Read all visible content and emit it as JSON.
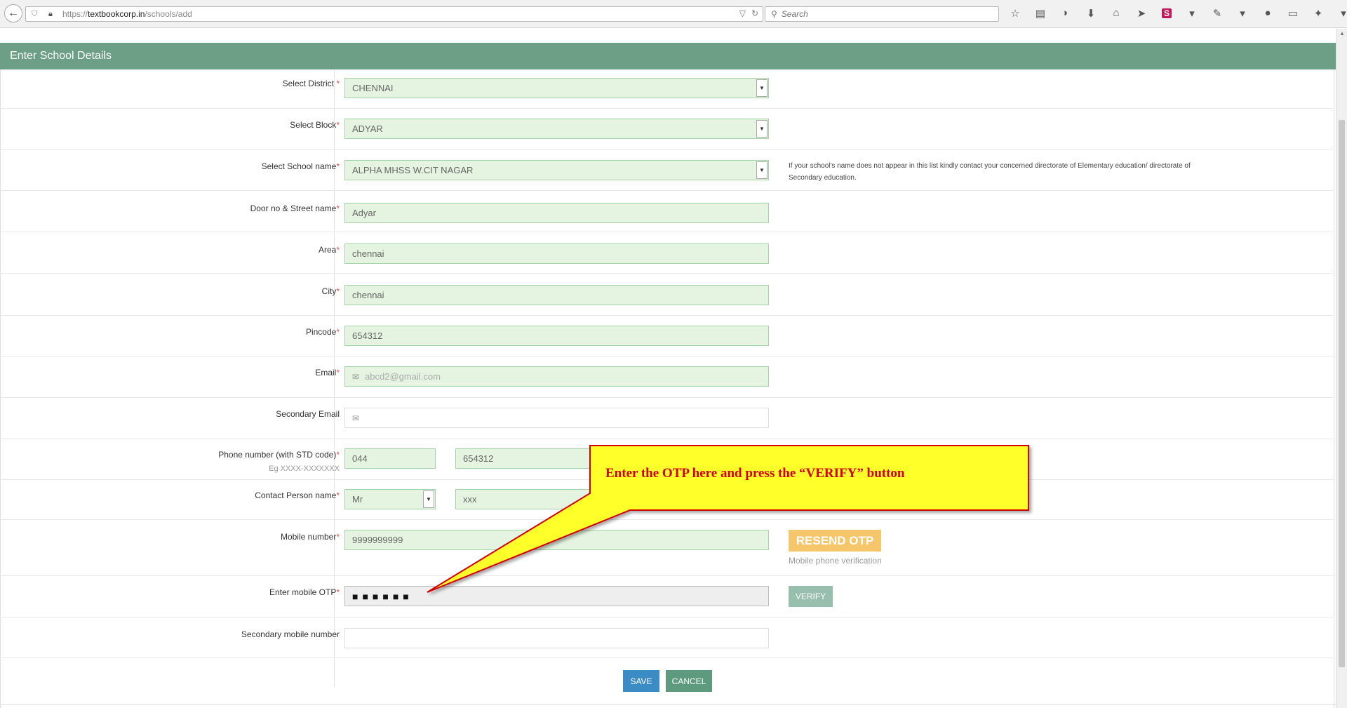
{
  "browser": {
    "url_prefix": "https://",
    "url_host": "textbookcorp.in",
    "url_path": "/schools/add",
    "search_placeholder": "Search",
    "profile_badge": "S"
  },
  "panel": {
    "title": "Enter School Details"
  },
  "form": {
    "district": {
      "label": "Select District",
      "value": "CHENNAI"
    },
    "block": {
      "label": "Select Block",
      "value": "ADYAR"
    },
    "school": {
      "label": "Select School name",
      "value": "ALPHA MHSS W.CIT NAGAR"
    },
    "school_note": "If your school's name does not appear in this list kindly contact your concerned directorate of Elementary education/ directorate of Secondary education.",
    "street": {
      "label": "Door no & Street name",
      "value": "Adyar"
    },
    "area": {
      "label": "Area",
      "value": "chennai"
    },
    "city": {
      "label": "City",
      "value": "chennai"
    },
    "pincode": {
      "label": "Pincode",
      "value": "654312"
    },
    "email": {
      "label": "Email",
      "placeholder": "abcd2@gmail.com"
    },
    "secondary_email": {
      "label": "Secondary Email",
      "value": ""
    },
    "phone": {
      "label": "Phone number (with STD code)",
      "hint": "Eg XXXX-XXXXXXX",
      "std": "044",
      "number": "654312"
    },
    "contact": {
      "label": "Contact Person name",
      "title": "Mr",
      "name": "xxx"
    },
    "mobile": {
      "label": "Mobile number",
      "value": "9999999999"
    },
    "otp": {
      "label": "Enter mobile OTP",
      "value": "■■■■■■"
    },
    "secondary_mobile": {
      "label": "Secondary mobile number",
      "value": ""
    },
    "required_mark": "*"
  },
  "buttons": {
    "resend": "RESEND OTP",
    "mobile_helper": "Mobile phone verification",
    "verify": "VERIFY",
    "save": "SAVE",
    "cancel": "CANCEL"
  },
  "callout": {
    "text": "Enter the OTP here and press the “VERIFY” button",
    "fill_color": "#ffff2a",
    "border_color": "#d40000"
  }
}
